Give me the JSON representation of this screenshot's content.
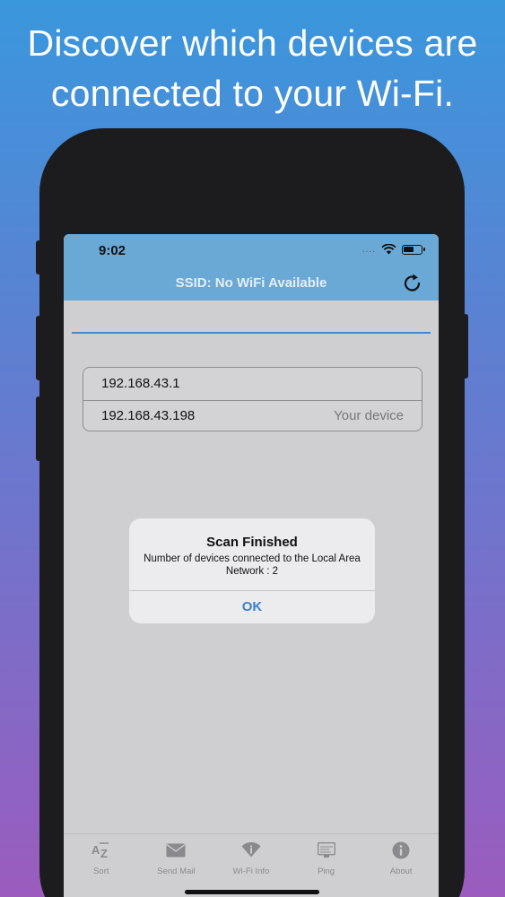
{
  "headline": {
    "line1": "Discover which devices are",
    "line2": "connected to your Wi-Fi."
  },
  "status_bar": {
    "time": "9:02",
    "dots": "...."
  },
  "navbar": {
    "ssid": "SSID: No WiFi Available",
    "refresh_icon": "refresh-icon"
  },
  "devices": [
    {
      "ip": "192.168.43.1",
      "tag": ""
    },
    {
      "ip": "192.168.43.198",
      "tag": "Your device"
    }
  ],
  "alert": {
    "title": "Scan Finished",
    "message": "Number of devices connected to the Local Area Network : 2",
    "ok_label": "OK"
  },
  "tabs": [
    {
      "label": "Sort",
      "icon": "sort-az-icon"
    },
    {
      "label": "Send Mail",
      "icon": "mail-icon"
    },
    {
      "label": "Wi-Fi Info",
      "icon": "wifi-info-icon"
    },
    {
      "label": "Ping",
      "icon": "ping-icon"
    },
    {
      "label": "About",
      "icon": "info-icon"
    }
  ],
  "colors": {
    "accent": "#3a7fd5",
    "navbar": "#6aa9d6",
    "tab_icon": "#8a8a8e"
  }
}
